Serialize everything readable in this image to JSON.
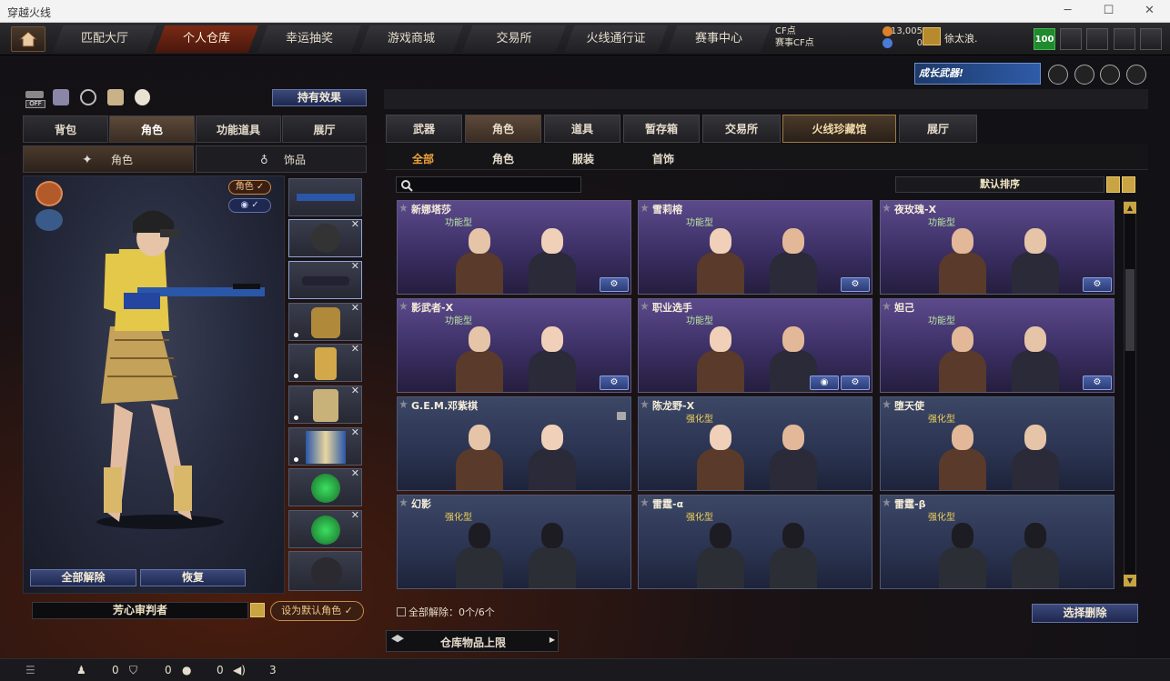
{
  "window": {
    "title": "穿越火线"
  },
  "nav": {
    "tabs": [
      "匹配大厅",
      "个人仓库",
      "幸运抽奖",
      "游戏商城",
      "交易所",
      "火线通行证",
      "赛事中心"
    ],
    "active": 1
  },
  "currency": {
    "cf_label": "CF点",
    "cf_value": "13,005",
    "match_label": "赛事CF点",
    "match_value": "0"
  },
  "user": {
    "name": "徐太浪.",
    "level": "100"
  },
  "banner": {
    "text": "成长武器!"
  },
  "left": {
    "off_label": "OFF",
    "effect_button": "持有效果",
    "tabs": [
      "背包",
      "角色",
      "功能道具",
      "展厅"
    ],
    "active_tab": 1,
    "subtabs": [
      "角色",
      "饰品"
    ],
    "role_pill": "角色",
    "release_all": "全部解除",
    "restore": "恢复",
    "character_name": "芳心审判者",
    "set_default": "设为默认角色"
  },
  "right": {
    "tabs": [
      "武器",
      "角色",
      "道具",
      "暂存箱",
      "交易所",
      "火线珍藏馆",
      "展厅"
    ],
    "active_tab": 1,
    "subtabs": [
      "全部",
      "角色",
      "服装",
      "首饰"
    ],
    "active_subtab": 0,
    "search_placeholder": "",
    "sort_label": "默认排序",
    "cards": [
      {
        "name": "新娜塔莎",
        "type": "功能型",
        "kind": "purple"
      },
      {
        "name": "雪莉榕",
        "type": "功能型",
        "kind": "purple"
      },
      {
        "name": "夜玫瑰-X",
        "type": "功能型",
        "kind": "purple"
      },
      {
        "name": "影武者-X",
        "type": "功能型",
        "kind": "purple"
      },
      {
        "name": "职业选手",
        "type": "功能型",
        "kind": "purple"
      },
      {
        "name": "妲己",
        "type": "功能型",
        "kind": "purple"
      },
      {
        "name": "G.E.M.邓紫棋",
        "type": "",
        "kind": "blue"
      },
      {
        "name": "陈龙野-X",
        "type": "强化型",
        "kind": "blue"
      },
      {
        "name": "堕天使",
        "type": "强化型",
        "kind": "blue"
      },
      {
        "name": "幻影",
        "type": "强化型",
        "kind": "blue"
      },
      {
        "name": "雷霆-α",
        "type": "强化型",
        "kind": "blue"
      },
      {
        "name": "雷霆-β",
        "type": "强化型",
        "kind": "blue"
      }
    ],
    "clear_status": "全部解除：0个/6个",
    "select_delete": "选择删除",
    "storage_limit": "仓库物品上限"
  },
  "status": {
    "friends": "0",
    "guild": "0",
    "messages": "0",
    "volume": "3"
  },
  "colors": {
    "accent": "#f0a23a",
    "active_nav": "#7a2a16"
  }
}
